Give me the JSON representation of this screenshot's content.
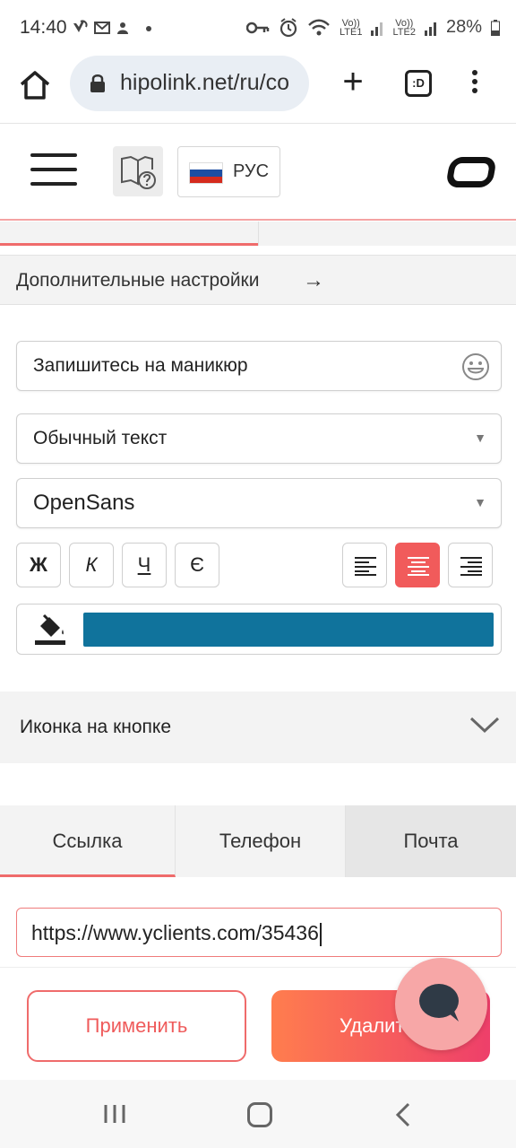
{
  "status": {
    "time": "14:40",
    "volte1": "Vo))\nLTE1",
    "volte2": "Vo))\nLTE2",
    "battery": "28%"
  },
  "browser": {
    "url": "hipolink.net/ru/co",
    "tabs_label": ":D"
  },
  "header": {
    "language": "РУС",
    "flag_colors": [
      "#ffffff",
      "#1c4ea3",
      "#d52b1e"
    ]
  },
  "advanced_settings": {
    "label": "Дополнительные настройки",
    "arrow": "→"
  },
  "button_text": {
    "value": "Запишитесь на маникюр"
  },
  "text_style": {
    "selected": "Обычный текст"
  },
  "font": {
    "selected": "OpenSans"
  },
  "formatting": {
    "bold": "Ж",
    "italic": "К",
    "underline": "Ч",
    "strike": "Є"
  },
  "colors": {
    "accent": "#ef5b5b",
    "text_color": "#10739c",
    "gradient_start": "#ff7d4e",
    "gradient_end": "#ee3f6a"
  },
  "icon_section": {
    "label": "Иконка на кнопке"
  },
  "link_tabs": [
    {
      "label": "Ссылка"
    },
    {
      "label": "Телефон"
    },
    {
      "label": "Почта"
    }
  ],
  "link": {
    "value": "https://www.yclients.com/35436"
  },
  "actions": {
    "apply": "Применить",
    "delete": "Удалить"
  }
}
